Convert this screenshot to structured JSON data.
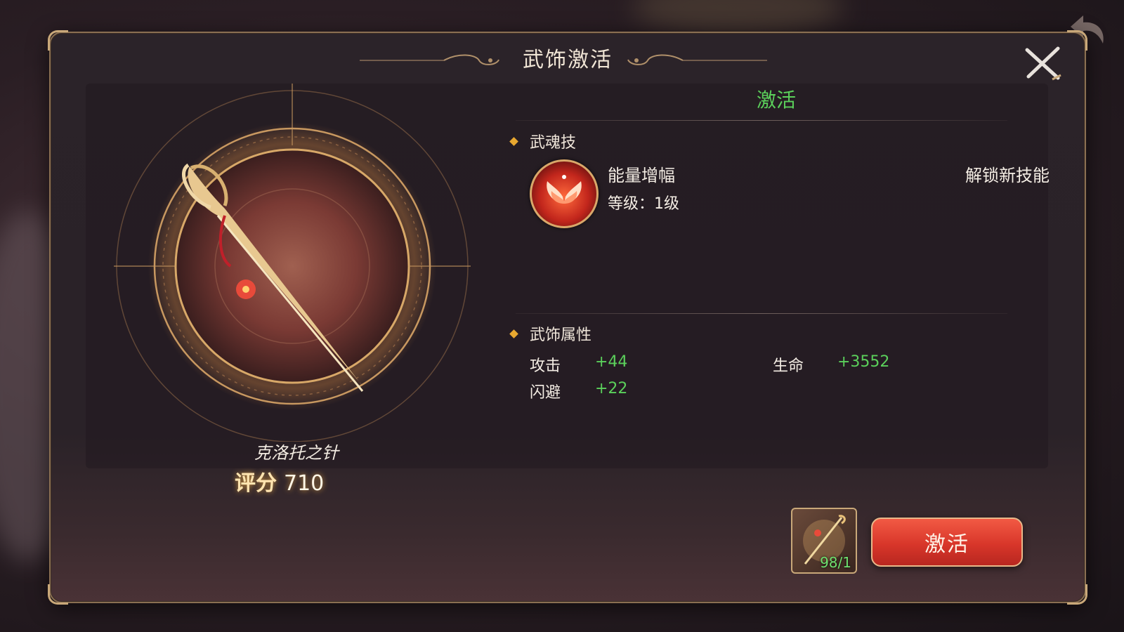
{
  "dialog": {
    "title": "武饰激活",
    "close_icon": "close-x-icon"
  },
  "weapon": {
    "name": "克洛托之针",
    "score_label": "评分",
    "score_value": "710"
  },
  "status": {
    "text": "激活"
  },
  "skill_section": {
    "heading": "武魂技",
    "skill_name": "能量增幅",
    "skill_level": "等级：1级",
    "unlock_text": "解锁新技能",
    "icon": "wings-icon"
  },
  "attr_section": {
    "heading": "武饰属性",
    "attributes": [
      {
        "label": "攻击",
        "value": "+44"
      },
      {
        "label": "生命",
        "value": "+3552"
      },
      {
        "label": "闪避",
        "value": "+22"
      }
    ]
  },
  "material": {
    "count": "98/1",
    "icon": "needle-item-icon"
  },
  "actions": {
    "activate_label": "激活"
  },
  "colors": {
    "accent_green": "#5bd05b",
    "button_red": "#d8362a",
    "frame_gold": "#c9a879"
  }
}
